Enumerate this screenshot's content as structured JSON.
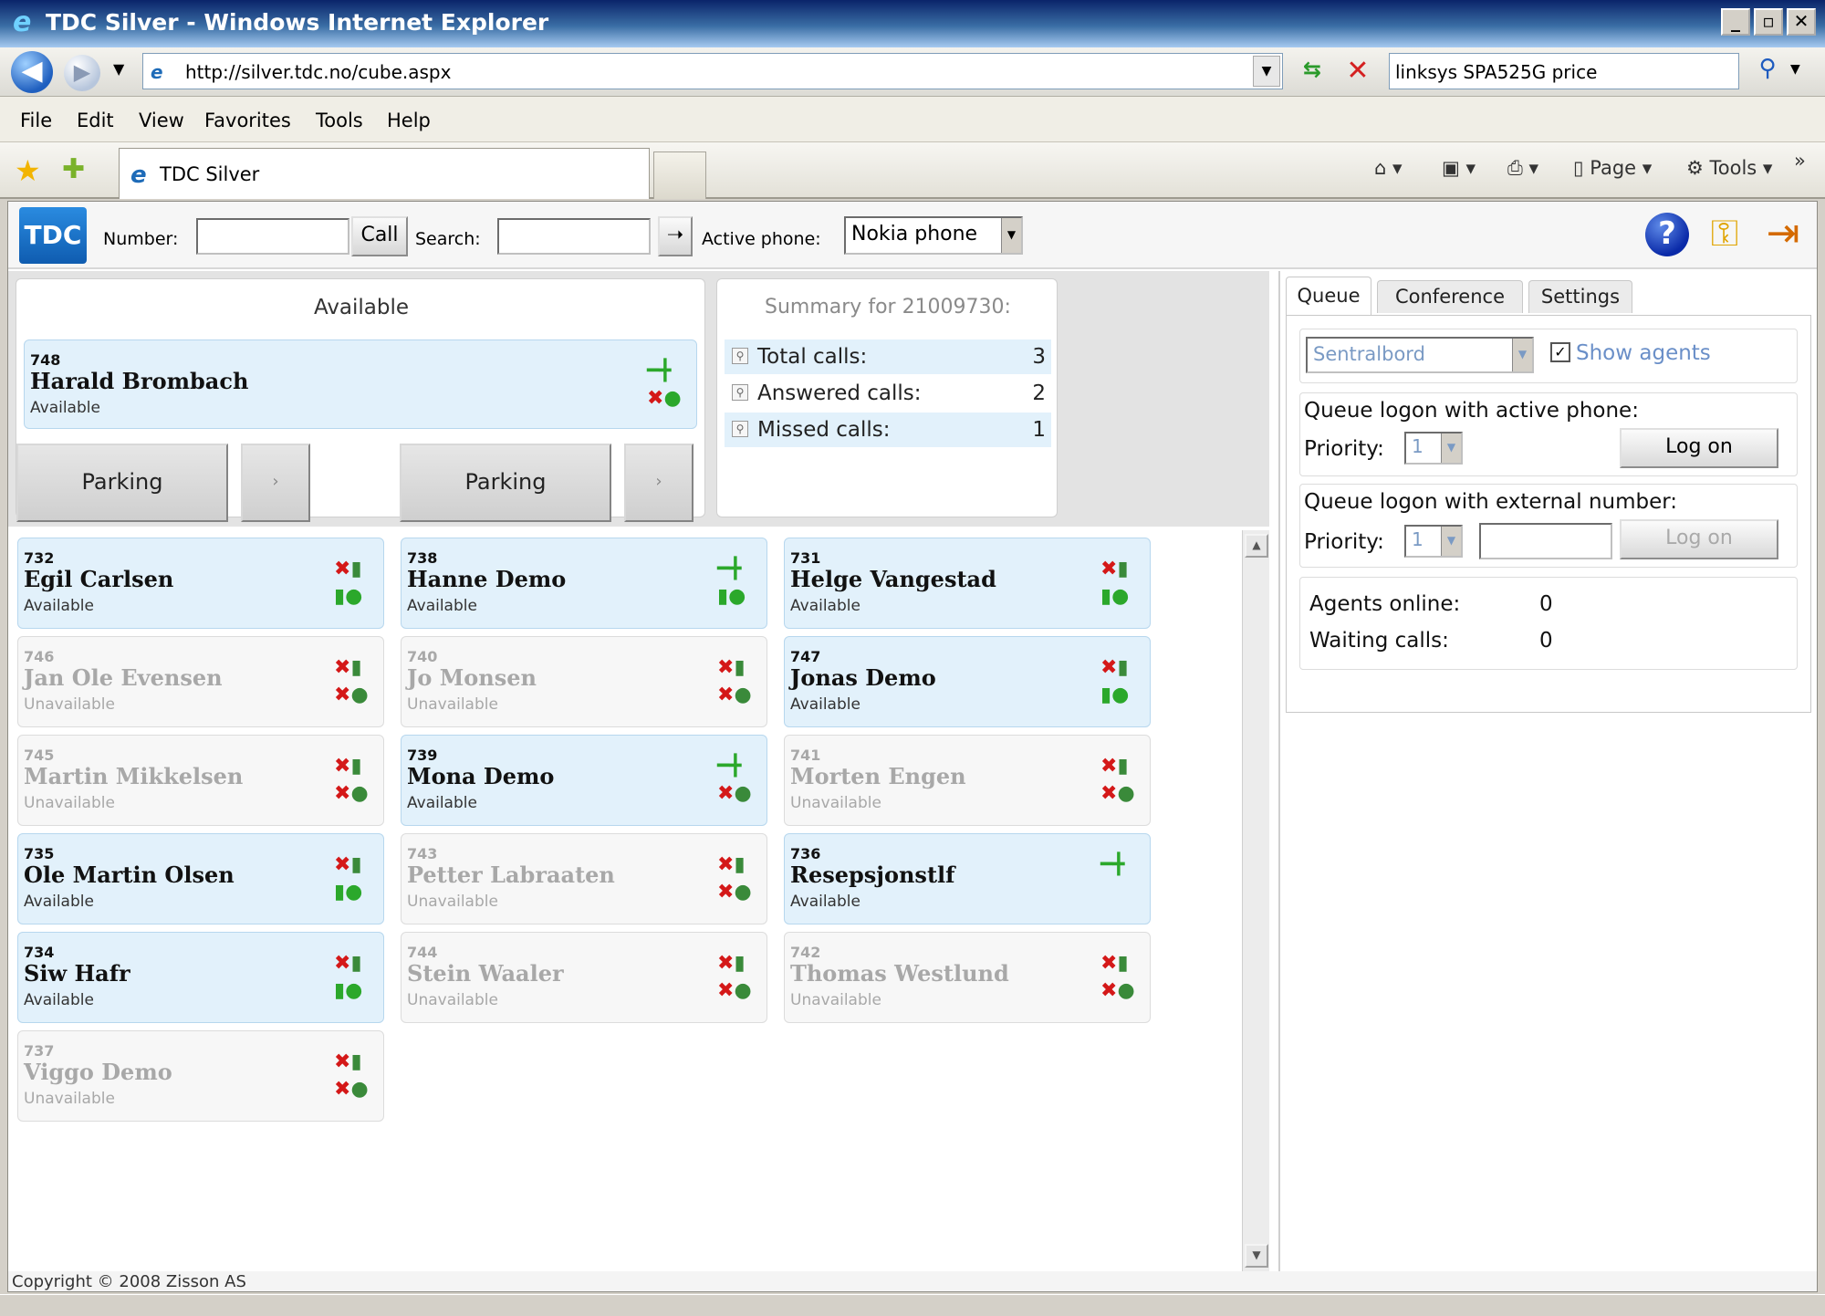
{
  "window": {
    "title": "TDC Silver - Windows Internet Explorer",
    "minimize": "_",
    "maximize": "▫",
    "close": "✕"
  },
  "address_bar": {
    "url": "http://silver.tdc.no/cube.aspx",
    "search_text": "linksys SPA525G price"
  },
  "menu": {
    "items": [
      "File",
      "Edit",
      "View",
      "Favorites",
      "Tools",
      "Help"
    ]
  },
  "browser_tab": {
    "label": "TDC Silver"
  },
  "command_bar": {
    "page": "Page",
    "tools": "Tools"
  },
  "app_toolbar": {
    "logo": "TDC",
    "number_label": "Number:",
    "number_value": "",
    "call_button": "Call",
    "search_label": "Search:",
    "search_value": "",
    "active_phone_label": "Active phone:",
    "active_phone_value": "Nokia phone"
  },
  "available_panel": {
    "title": "Available",
    "card": {
      "ext": "748",
      "name": "Harald Brombach",
      "status": "Available"
    },
    "parking_left": "Parking",
    "parking_right": "Parking",
    "small_btn": "›"
  },
  "summary": {
    "title": "Summary for 21009730:",
    "rows": [
      {
        "label": "Total calls:",
        "value": "3"
      },
      {
        "label": "Answered calls:",
        "value": "2"
      },
      {
        "label": "Missed calls:",
        "value": "1"
      }
    ]
  },
  "extensions": [
    {
      "ext": "732",
      "name": "Egil Carlsen",
      "status": "Available",
      "available": true,
      "icon_top": "x",
      "icon_bottom": "g"
    },
    {
      "ext": "738",
      "name": "Hanne Demo",
      "status": "Available",
      "available": true,
      "icon_top": "g",
      "icon_bottom": "g"
    },
    {
      "ext": "731",
      "name": "Helge Vangestad",
      "status": "Available",
      "available": true,
      "icon_top": "x",
      "icon_bottom": "g"
    },
    {
      "ext": "746",
      "name": "Jan Ole Evensen",
      "status": "Unavailable",
      "available": false,
      "icon_top": "x",
      "icon_bottom": "x"
    },
    {
      "ext": "740",
      "name": "Jo Monsen",
      "status": "Unavailable",
      "available": false,
      "icon_top": "x",
      "icon_bottom": "x"
    },
    {
      "ext": "747",
      "name": "Jonas Demo",
      "status": "Available",
      "available": true,
      "icon_top": "x",
      "icon_bottom": "g"
    },
    {
      "ext": "745",
      "name": "Martin Mikkelsen",
      "status": "Unavailable",
      "available": false,
      "icon_top": "x",
      "icon_bottom": "x"
    },
    {
      "ext": "739",
      "name": "Mona Demo",
      "status": "Available",
      "available": true,
      "icon_top": "g",
      "icon_bottom": "x"
    },
    {
      "ext": "741",
      "name": "Morten Engen",
      "status": "Unavailable",
      "available": false,
      "icon_top": "x",
      "icon_bottom": "x"
    },
    {
      "ext": "735",
      "name": "Ole Martin Olsen",
      "status": "Available",
      "available": true,
      "icon_top": "x",
      "icon_bottom": "g"
    },
    {
      "ext": "743",
      "name": "Petter Labraaten",
      "status": "Unavailable",
      "available": false,
      "icon_top": "x",
      "icon_bottom": "x"
    },
    {
      "ext": "736",
      "name": "Resepsjonstlf",
      "status": "Available",
      "available": true,
      "icon_top": "g",
      "icon_bottom": ""
    },
    {
      "ext": "734",
      "name": "Siw Hafr",
      "status": "Available",
      "available": true,
      "icon_top": "x",
      "icon_bottom": "g"
    },
    {
      "ext": "744",
      "name": "Stein Waaler",
      "status": "Unavailable",
      "available": false,
      "icon_top": "x",
      "icon_bottom": "x"
    },
    {
      "ext": "742",
      "name": "Thomas Westlund",
      "status": "Unavailable",
      "available": false,
      "icon_top": "x",
      "icon_bottom": "x"
    },
    {
      "ext": "737",
      "name": "Viggo Demo",
      "status": "Unavailable",
      "available": false,
      "icon_top": "x",
      "icon_bottom": "x"
    }
  ],
  "right_panel": {
    "tabs": [
      "Queue",
      "Conference",
      "Settings"
    ],
    "queue_select": "Sentralbord",
    "show_agents_label": "Show agents",
    "show_agents_checked": true,
    "active_phone_heading": "Queue logon with active phone:",
    "priority_label": "Priority:",
    "priority_value_1": "1",
    "logon_button": "Log on",
    "external_heading": "Queue logon with external number:",
    "priority_value_2": "1",
    "external_number": "",
    "logon_button_disabled": "Log on",
    "agents_online_label": "Agents online:",
    "agents_online_value": "0",
    "waiting_calls_label": "Waiting calls:",
    "waiting_calls_value": "0"
  },
  "footer": {
    "copyright": "Copyright © 2008 Zisson AS"
  },
  "colors": {
    "available_bg": "#e2f1fb",
    "unavailable_bg": "#f7f7f7",
    "ie_title_blue": "#0a246a",
    "red_x": "#d41818",
    "green": "#2ba82b"
  }
}
